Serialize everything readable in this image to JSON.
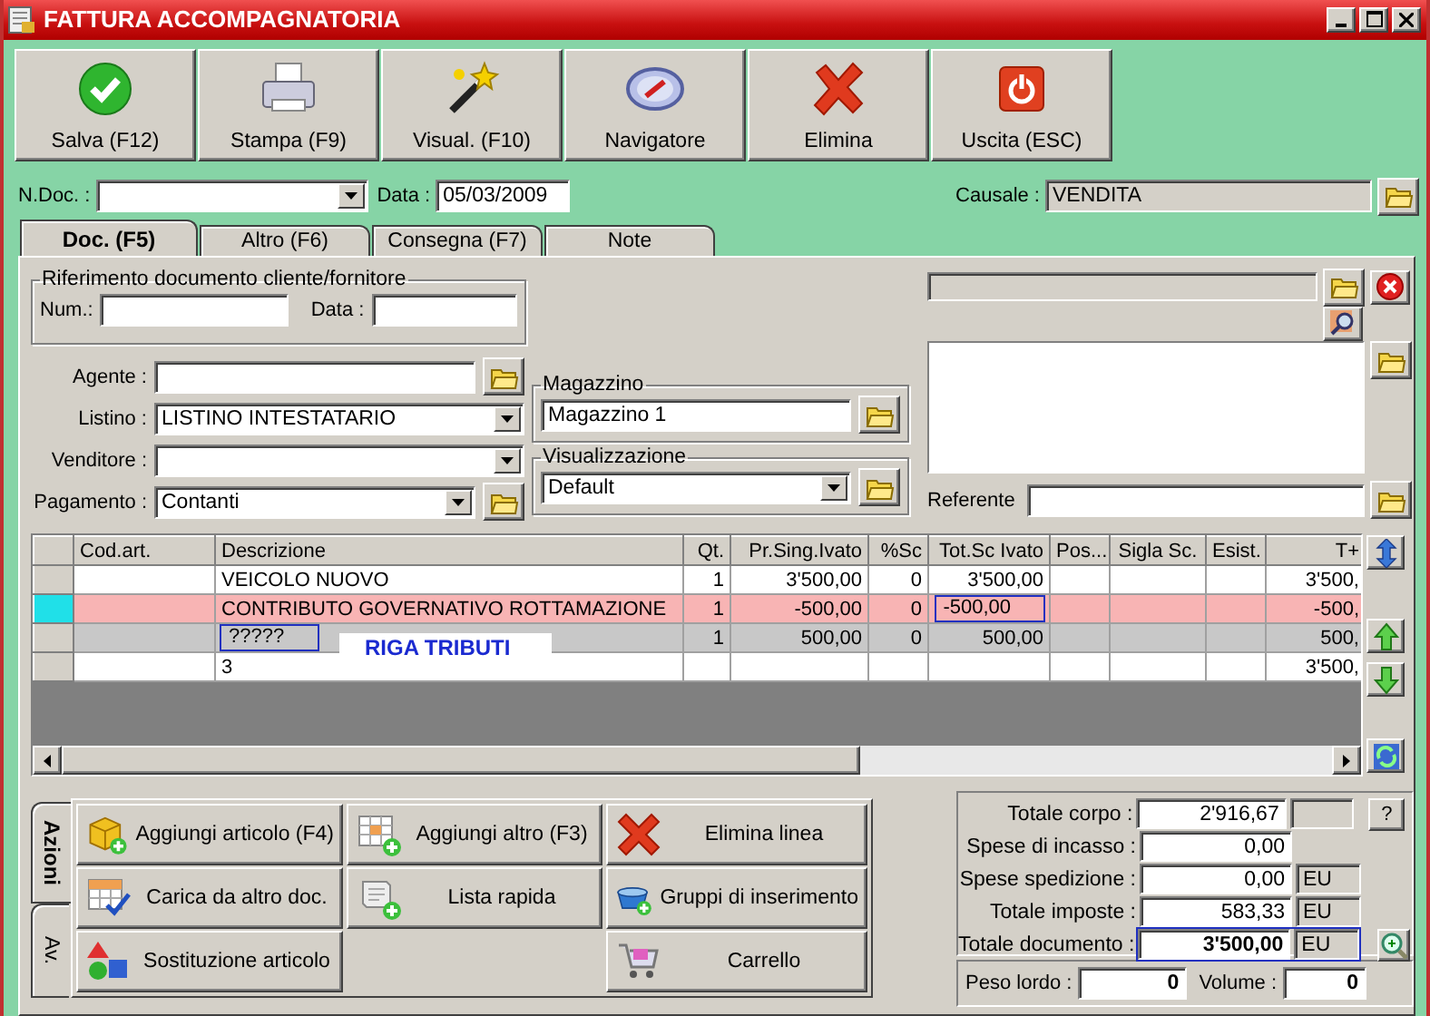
{
  "window": {
    "title": "FATTURA ACCOMPAGNATORIA"
  },
  "toolbar": [
    {
      "label": "Salva (F12)"
    },
    {
      "label": "Stampa (F9)"
    },
    {
      "label": "Visual. (F10)"
    },
    {
      "label": "Navigatore"
    },
    {
      "label": "Elimina"
    },
    {
      "label": "Uscita (ESC)"
    }
  ],
  "header": {
    "n_doc_label": "N.Doc. :",
    "data_label": "Data :",
    "data_value": "05/03/2009",
    "causale_label": "Causale :",
    "causale_value": "VENDITA"
  },
  "tabs": [
    {
      "label": "Doc. (F5)",
      "selected": true
    },
    {
      "label": "Altro (F6)",
      "selected": false
    },
    {
      "label": "Consegna (F7)",
      "selected": false
    },
    {
      "label": "Note",
      "selected": false
    }
  ],
  "riferimento": {
    "title": "Riferimento documento cliente/fornitore",
    "num_label": "Num.:",
    "data_label": "Data :"
  },
  "fields": [
    {
      "label": "Agente :",
      "kind": "text_folder"
    },
    {
      "label": "Listino :",
      "kind": "combo",
      "value": "LISTINO INTESTATARIO"
    },
    {
      "label": "Venditore :",
      "kind": "combo"
    },
    {
      "label": "Pagamento :",
      "kind": "combo_folder",
      "value": "Contanti"
    }
  ],
  "magazzino": {
    "title": "Magazzino",
    "value": "Magazzino 1"
  },
  "visualizzazione": {
    "title": "Visualizzazione",
    "value": "Default"
  },
  "referente_label": "Referente",
  "grid": {
    "columns": [
      {
        "label": "Cod.art."
      },
      {
        "label": "Descrizione"
      },
      {
        "label": "Qt."
      },
      {
        "label": "Pr.Sing.Ivato"
      },
      {
        "label": "%Sc"
      },
      {
        "label": "Tot.Sc Ivato"
      },
      {
        "label": "Pos..."
      },
      {
        "label": "Sigla Sc."
      },
      {
        "label": "Esist."
      },
      {
        "label": "T+"
      }
    ],
    "rows": [
      {
        "kind": "article",
        "selected": false,
        "cells": {
          "descrizione": "VEICOLO NUOVO",
          "qt": "1",
          "pr_sing_ivato": "3'500,00",
          "sc": "0",
          "tot_sc_ivato": "3'500,00",
          "t_plus": "3'500,"
        }
      },
      {
        "kind": "article",
        "selected": true,
        "cells": {
          "descrizione": "CONTRIBUTO GOVERNATIVO ROTTAMAZIONE",
          "qt": "1",
          "pr_sing_ivato": "-500,00",
          "sc": "0",
          "tot_sc_ivato": {
            "text": "-500,00",
            "focused": true
          },
          "t_plus": "-500,"
        }
      },
      {
        "kind": "tax",
        "selected": false,
        "cells": {
          "descrizione": {
            "text": "?????",
            "focused": true
          },
          "qt": "1",
          "pr_sing_ivato": "500,00",
          "sc": "0",
          "tot_sc_ivato": "500,00",
          "t_plus": "500,"
        }
      },
      {
        "kind": "article",
        "selected": false,
        "cells": {
          "descrizione": "3",
          "t_plus": "3'500,"
        }
      }
    ],
    "overlay_label": "RIGA TRIBUTI"
  },
  "action_tabs": [
    {
      "label": "Azioni",
      "selected": true
    },
    {
      "label": "Av.",
      "selected": false
    }
  ],
  "actions": [
    [
      {
        "label": "Aggiungi articolo (F4)"
      },
      {
        "label": "Carica da altro doc."
      },
      {
        "label": "Sostituzione articolo"
      }
    ],
    [
      {
        "label": "Aggiungi altro (F3)"
      },
      {
        "label": "Lista rapida"
      }
    ],
    [
      {
        "label": "Elimina linea"
      },
      {
        "label": "Gruppi di inserimento"
      },
      {
        "label": "Carrello"
      }
    ]
  ],
  "totals": [
    {
      "kind": "help",
      "label": "Totale corpo :",
      "value": "2'916,67",
      "button": "?"
    },
    {
      "kind": "plain",
      "label": "Spese di incasso :",
      "value": "0,00"
    },
    {
      "kind": "plain",
      "label": "Spese spedizione :",
      "value": "0,00",
      "unit": "EU"
    },
    {
      "kind": "plain",
      "label": "Totale imposte :",
      "value": "583,33",
      "unit": "EU"
    },
    {
      "kind": "document",
      "label": "Totale documento :",
      "value": "3'500,00",
      "unit": "EU"
    }
  ],
  "weights": {
    "peso_label": "Peso lordo :",
    "peso_value": "0",
    "volume_label": "Volume :",
    "volume_value": "0"
  }
}
